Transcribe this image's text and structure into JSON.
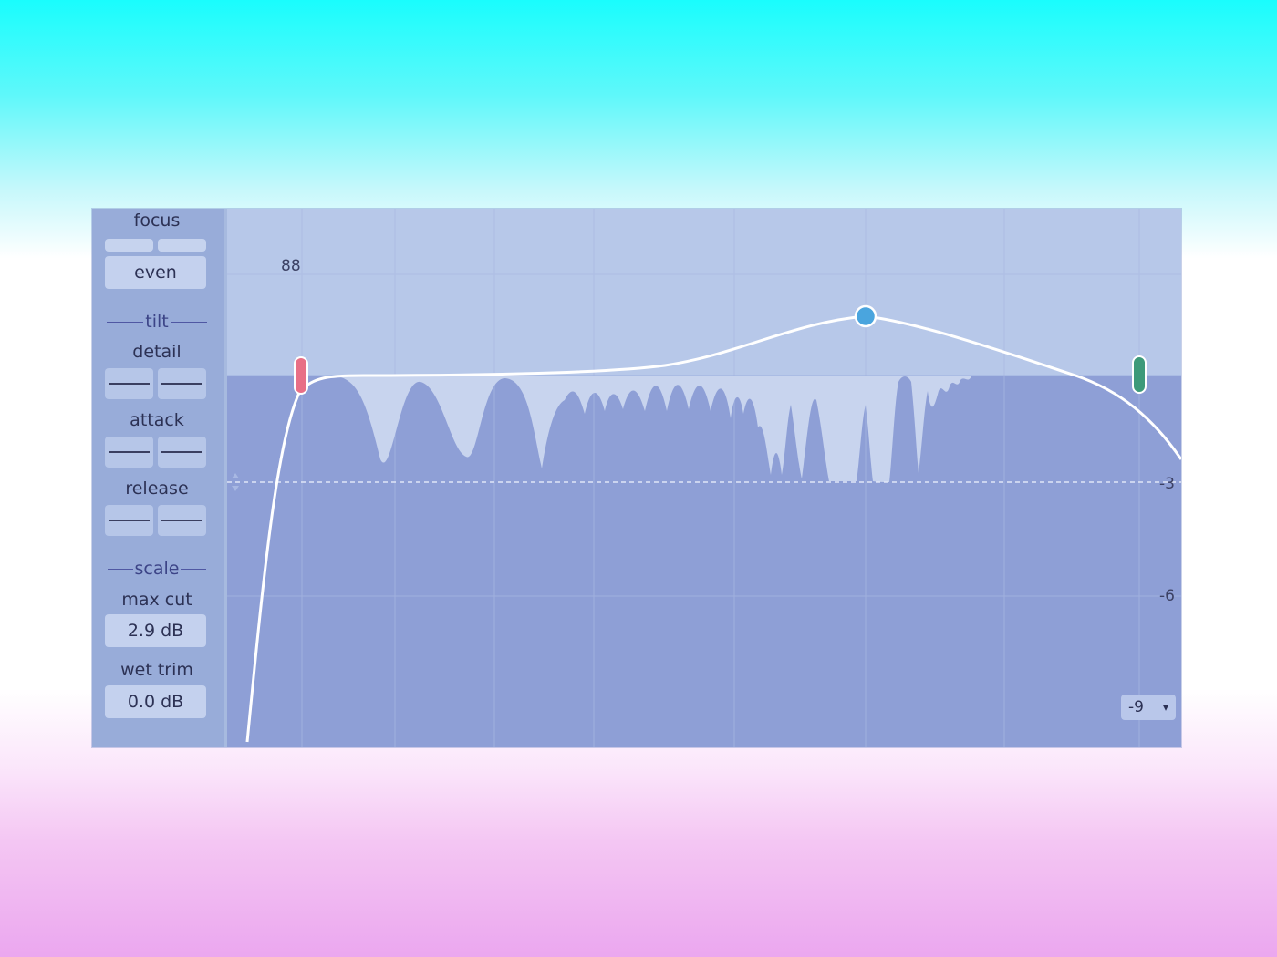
{
  "sidebar": {
    "focus_label": "focus",
    "focus_mode": "even",
    "tilt_label": "tilt",
    "detail_label": "detail",
    "attack_label": "attack",
    "release_label": "release",
    "scale_label": "scale",
    "max_cut_label": "max cut",
    "max_cut_value": "2.9 dB",
    "wet_trim_label": "wet trim",
    "wet_trim_value": "0.0 dB"
  },
  "graph": {
    "readout": "88",
    "db_labels": [
      "-3",
      "-6"
    ],
    "range_value": "-9",
    "range_caret": "▾"
  },
  "colors": {
    "background_top": "#19fdfd",
    "background_bottom": "#eba7ef",
    "panel": "#8e9fd6",
    "low_handle": "#e86f86",
    "mid_handle": "#4aa5de",
    "high_handle": "#3d9a7a"
  }
}
